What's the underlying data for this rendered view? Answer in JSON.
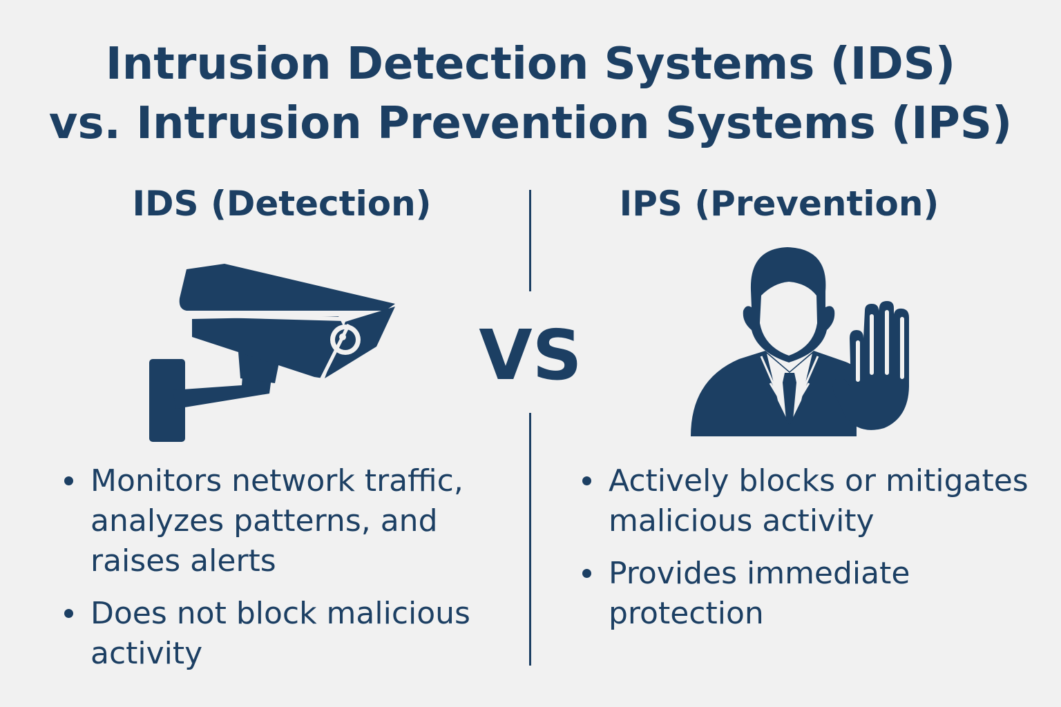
{
  "title": {
    "line1": "Intrusion Detection Systems (IDS)",
    "line2": "vs. Intrusion Prevention Systems (IPS)"
  },
  "ids": {
    "heading": "IDS (Detection)",
    "icon": "security-camera-icon",
    "bullets": [
      "Monitors network traffic, analyzes patterns, and raises alerts",
      "Does not block malicious activity"
    ]
  },
  "vs_label": "VS",
  "ips": {
    "heading": "IPS (Prevention)",
    "icon": "person-stop-hand-icon",
    "bullets": [
      "Actively blocks or mitigates malicious activity",
      "Provides immediate protection"
    ]
  },
  "colors": {
    "primary": "#1c3f63",
    "background": "#f1f1f1"
  }
}
